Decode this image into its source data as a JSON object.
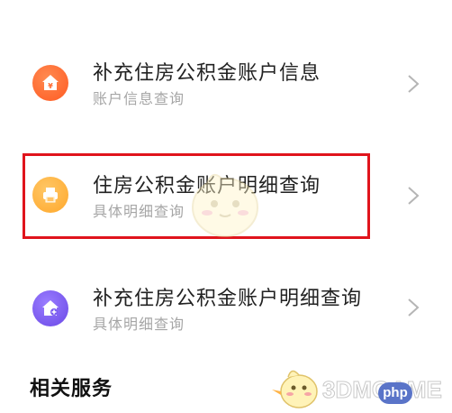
{
  "list_items": [
    {
      "title": "补充住房公积金账户信息",
      "subtitle": "账户信息查询",
      "icon": "house-yen-icon",
      "icon_color": "#ff6a30"
    },
    {
      "title": "住房公积金账户明细查询",
      "subtitle": "具体明细查询",
      "icon": "printer-icon",
      "icon_color": "#ffb13d"
    },
    {
      "title": "补充住房公积金账户明细查询",
      "subtitle": "具体明细查询",
      "icon": "house-add-icon",
      "icon_color": "#7b5cf0"
    }
  ],
  "section": {
    "title": "相关服务"
  },
  "highlight_color": "#e0141c",
  "watermark": {
    "brand": "3DMGAME",
    "badge": "php"
  }
}
